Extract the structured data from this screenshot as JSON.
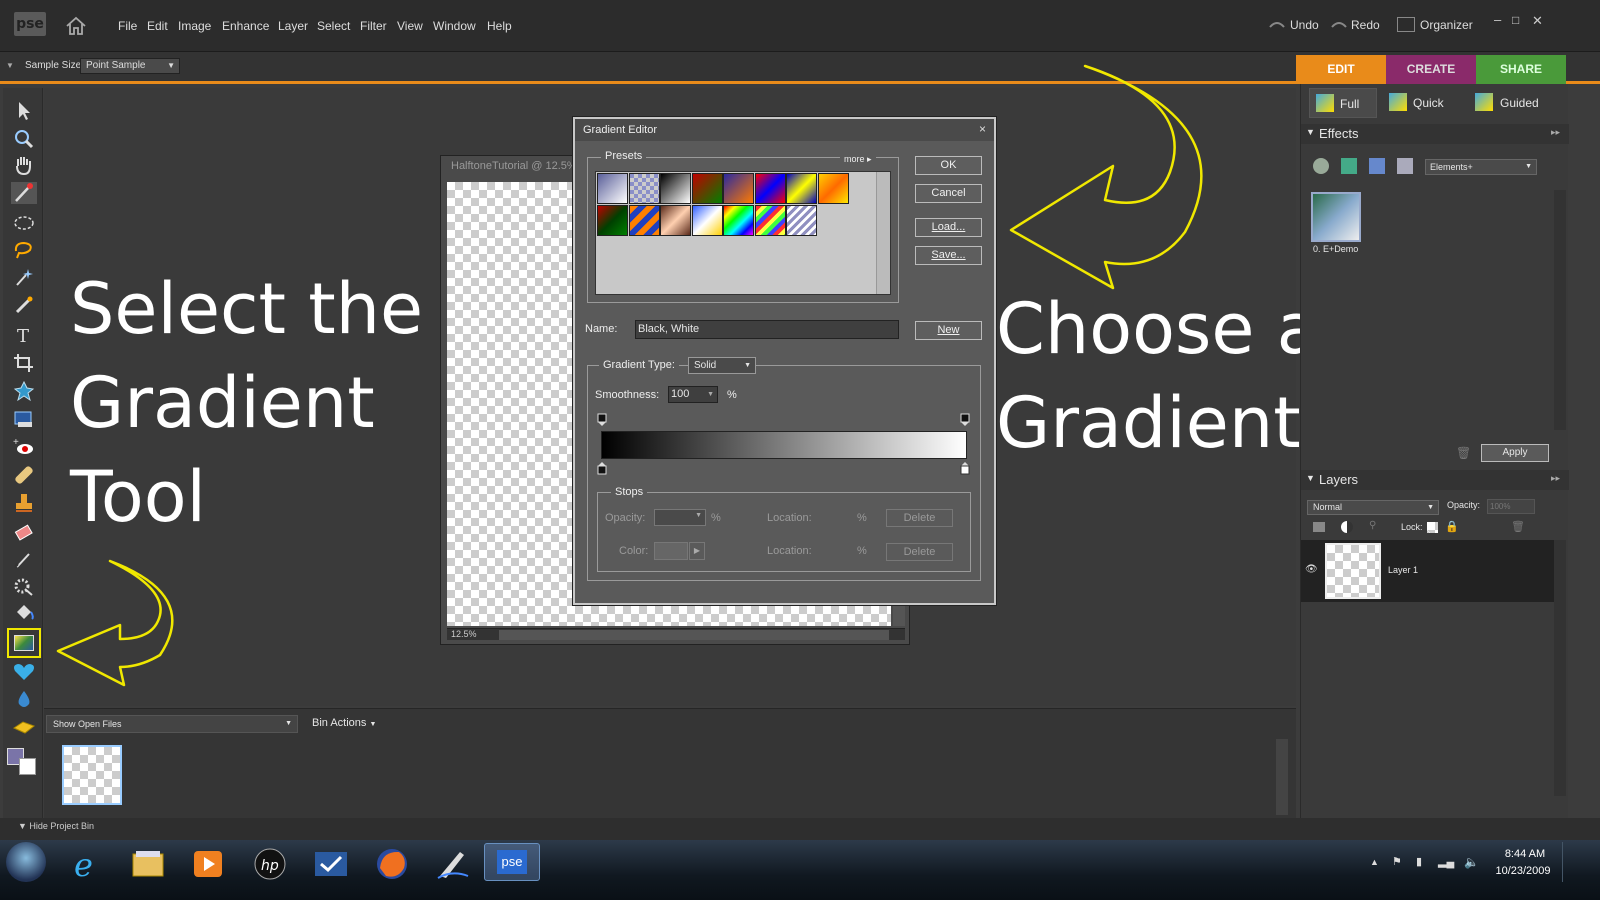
{
  "app": {
    "logo": "pse",
    "menu": [
      "File",
      "Edit",
      "Image",
      "Enhance",
      "Layer",
      "Select",
      "Filter",
      "View",
      "Window",
      "Help"
    ],
    "undo": "Undo",
    "redo": "Redo",
    "organizer": "Organizer"
  },
  "options_bar": {
    "sample_size_label": "Sample Size:",
    "sample_size_value": "Point Sample"
  },
  "mode_tabs": {
    "edit": "EDIT",
    "create": "CREATE",
    "share": "SHARE"
  },
  "edit_modes": {
    "full": "Full",
    "quick": "Quick",
    "guided": "Guided"
  },
  "document": {
    "title": "HalftoneTutorial @ 12.5%",
    "zoom": "12.5%"
  },
  "gradient_editor": {
    "title": "Gradient Editor",
    "close": "×",
    "presets_label": "Presets",
    "more_label": "more",
    "ok": "OK",
    "cancel": "Cancel",
    "load": "Load...",
    "save": "Save...",
    "name_label": "Name:",
    "name_value": "Black, White",
    "new_button": "New",
    "gradient_type_label": "Gradient Type:",
    "gradient_type_value": "Solid",
    "smoothness_label": "Smoothness:",
    "smoothness_value": "100",
    "percent": "%",
    "stops_label": "Stops",
    "opacity_label": "Opacity:",
    "color_label": "Color:",
    "location_label": "Location:",
    "delete_label": "Delete",
    "presets": [
      "linear-gradient(135deg,#5a5f9a,#ffffff)",
      "repeating-conic-gradient(#ccc 0 25%,#8a8fc8 0 50%) 0 0/8px 8px",
      "linear-gradient(135deg,#000,#fff)",
      "linear-gradient(135deg,#c00000,#008000)",
      "linear-gradient(135deg,#2a2aa0,#ff7a00)",
      "linear-gradient(135deg,#ff0000,#0000ff,#ff0000)",
      "linear-gradient(135deg,#0000c0,#ffff00,#0000c0)",
      "linear-gradient(135deg,#ffd000,#ff6a00,#ffe800)",
      "linear-gradient(135deg,#c00000,#004000,#008000)",
      "repeating-linear-gradient(135deg,#ff8000 0 6px,#2040c0 6px 12px)",
      "linear-gradient(135deg,#5a2a1a,#ffd0b0,#5a2a1a)",
      "linear-gradient(135deg,#3060ff,#ffffff,#ffd000)",
      "linear-gradient(135deg,#ff0000,#ffff00,#00ff00,#00ffff,#0000ff,#ff00ff)",
      "repeating-linear-gradient(135deg,#ff3030 0 4px,#ffff40 4px 8px,#40ff40 8px 12px,#4040ff 12px 16px)",
      "repeating-linear-gradient(135deg,#9090c0 0 3px,#ffffff 3px 6px)"
    ]
  },
  "annotations": {
    "left_line1": "Select the",
    "left_line2": "Gradient",
    "left_line3": "Tool",
    "right_line1": "Choose a",
    "right_line2": "Gradient"
  },
  "effects_panel": {
    "title": "Effects",
    "dropdown": "Elements+",
    "item_label": "0. E+Demo",
    "apply": "Apply"
  },
  "layers_panel": {
    "title": "Layers",
    "blend_mode": "Normal",
    "opacity_label": "Opacity:",
    "opacity_value": "100%",
    "lock_label": "Lock:",
    "layer_name": "Layer 1"
  },
  "project_bin": {
    "show_files": "Show Open Files",
    "bin_actions": "Bin Actions",
    "hide_label": "Hide Project Bin"
  },
  "taskbar": {
    "time": "8:44 AM",
    "date": "10/23/2009",
    "pse_label": "pse"
  },
  "colors": {
    "highlight_yellow": "#f0e800",
    "edit_tab": "#e98b1a",
    "create_tab": "#8a2a6a",
    "share_tab": "#4a9a3a"
  }
}
